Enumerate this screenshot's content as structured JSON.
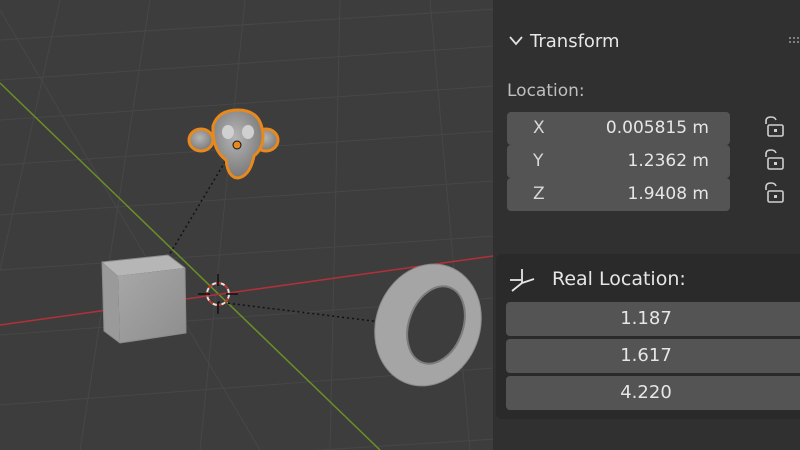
{
  "transform": {
    "title": "Transform",
    "location_label": "Location:",
    "fields": [
      {
        "axis": "X",
        "value": "0.005815 m"
      },
      {
        "axis": "Y",
        "value": "1.2362 m"
      },
      {
        "axis": "Z",
        "value": "1.9408 m"
      }
    ]
  },
  "real_location": {
    "title": "Real Location:",
    "values": [
      "1.187",
      "1.617",
      "4.220"
    ]
  },
  "colors": {
    "selection_outline": "#e8891e",
    "x_axis": "#b3303a",
    "y_axis": "#6b8f26",
    "panel_bg": "#303030",
    "field_bg": "#545454"
  }
}
